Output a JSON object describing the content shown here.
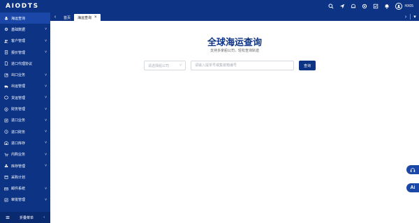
{
  "app": {
    "logo": "AIODTS",
    "username": "HX05"
  },
  "topbar": {
    "icons": [
      "search-icon",
      "send-icon",
      "bell-outline-icon",
      "settings-icon",
      "checkbox-icon",
      "bell-icon",
      "user-icon"
    ]
  },
  "sidebar": {
    "items": [
      {
        "label": "海运查询",
        "icon": "ship-icon",
        "arrow": "",
        "active": true
      },
      {
        "label": "基础数据",
        "icon": "gear-icon",
        "arrow": "˅"
      },
      {
        "label": "客户管理",
        "icon": "people-icon",
        "arrow": "˅"
      },
      {
        "label": "报价管理",
        "icon": "quote-icon",
        "arrow": "˅"
      },
      {
        "label": "进口代理协议",
        "icon": "doc-icon",
        "arrow": ""
      },
      {
        "label": "出口业务",
        "icon": "export-icon",
        "arrow": "˅"
      },
      {
        "label": "出运管理",
        "icon": "truck-icon",
        "arrow": "˅"
      },
      {
        "label": "货运管理",
        "icon": "box-icon",
        "arrow": "˅"
      },
      {
        "label": "财务管理",
        "icon": "money-icon",
        "arrow": "˅"
      },
      {
        "label": "进口业务",
        "icon": "import-icon",
        "arrow": "˅"
      },
      {
        "label": "进口财务",
        "icon": "clock-icon",
        "arrow": "˅"
      },
      {
        "label": "进口库存",
        "icon": "warehouse-icon",
        "arrow": "˅"
      },
      {
        "label": "内购业务",
        "icon": "cart-icon",
        "arrow": "˅"
      },
      {
        "label": "库存管理",
        "icon": "stock-icon",
        "arrow": "˅"
      },
      {
        "label": "采购计划",
        "icon": "plan-icon",
        "arrow": ""
      },
      {
        "label": "邮件系统",
        "icon": "mail-icon",
        "arrow": "˅"
      },
      {
        "label": "审批管理",
        "icon": "approve-icon",
        "arrow": "˅"
      }
    ],
    "footer": {
      "label": "折叠菜单",
      "icon": "menu-icon",
      "arrow": "‹"
    }
  },
  "tabs": {
    "items": [
      {
        "label": "首页",
        "current": false
      },
      {
        "label": "海运查询",
        "current": true,
        "close": "×"
      }
    ],
    "left_nav": "‹",
    "right_nav": "›",
    "dropdown": "▾"
  },
  "main": {
    "title": "全球海运查询",
    "subtitle": "支持多家船公司，轻松查询轨迹",
    "select_placeholder": "请选择船公司",
    "select_arrow": "˅",
    "input_placeholder": "请输入提单号或集装箱编号",
    "search_button": "查询"
  },
  "floating": {
    "ai_label": "Ai"
  },
  "colors": {
    "primary": "#0d3385",
    "active": "#1a47a8",
    "subtitle": "#666666"
  }
}
